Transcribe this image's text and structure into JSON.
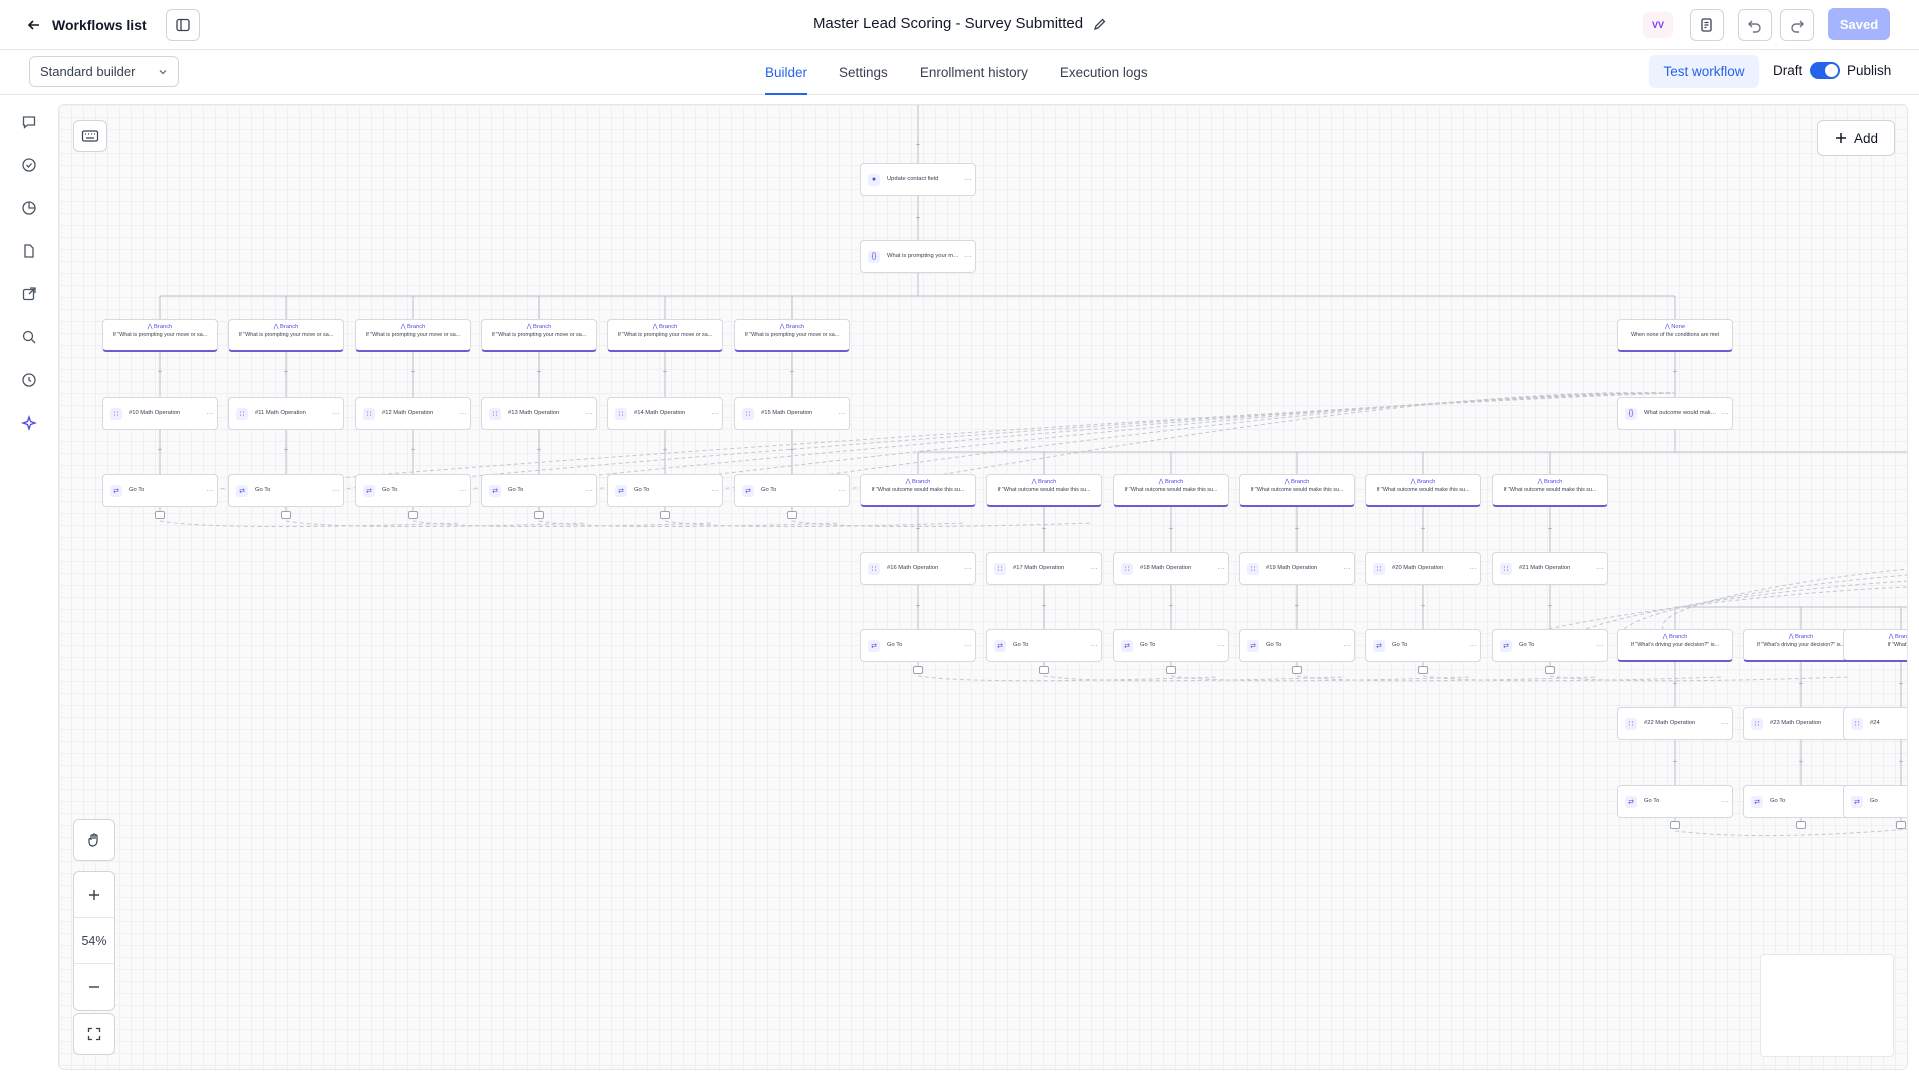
{
  "header": {
    "back_label": "Workflows list",
    "title": "Master Lead Scoring - Survey Submitted",
    "avatar_text": "VV",
    "saved_label": "Saved"
  },
  "subbar": {
    "builder_select": "Standard builder",
    "tabs": [
      {
        "label": "Builder",
        "active": true
      },
      {
        "label": "Settings",
        "active": false
      },
      {
        "label": "Enrollment history",
        "active": false
      },
      {
        "label": "Execution logs",
        "active": false
      }
    ],
    "test_label": "Test workflow",
    "draft_label": "Draft",
    "publish_label": "Publish",
    "publish_on": true
  },
  "canvas": {
    "add_label": "Add",
    "zoom_label": "54%"
  },
  "flow": {
    "top_nodes": [
      {
        "label": "Update contact field",
        "icon": "user-icon"
      },
      {
        "label": "What is prompting your move or sale?",
        "icon": "braces-icon"
      }
    ],
    "branch_title": "Branch",
    "none_title": "None",
    "none_text": "When none of the conditions are met",
    "branch_text_1": "If \"What is prompting your move or sa...",
    "branch_text_2": "If \"What outcome would make this su...",
    "branch_text_3": "If \"What's driving your decision?\" is...",
    "branch_text_3_cut": "If \"What's c",
    "decision_node_2": "What outcome would make this successful?",
    "goto_label": "Go To",
    "goto_cut": "Go",
    "math_row_1": [
      "#10 Math Operation",
      "#11 Math Operation",
      "#12 Math Operation",
      "#13 Math Operation",
      "#14 Math Operation",
      "#15 Math Operation"
    ],
    "math_row_2": [
      "#16 Math Operation",
      "#17 Math Operation",
      "#18 Math Operation",
      "#19 Math Operation",
      "#20 Math Operation",
      "#21 Math Operation"
    ],
    "math_row_3": [
      "#22 Math Operation",
      "#23 Math Operation",
      "#24"
    ]
  },
  "colors": {
    "accent": "#2563eb",
    "branch_underline": "#6d5bd0",
    "saved_bg": "#a5b4fc"
  }
}
